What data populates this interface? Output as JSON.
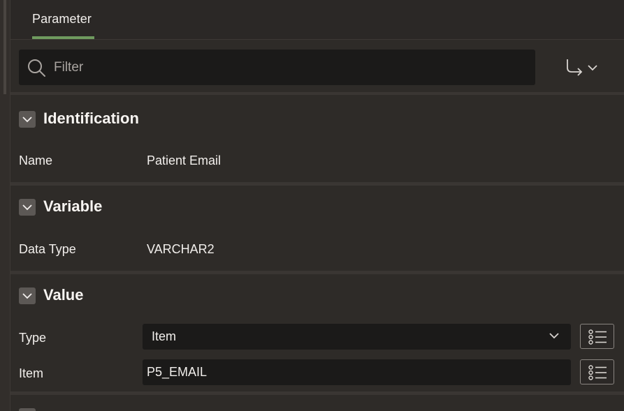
{
  "tabs": [
    {
      "label": "Parameter",
      "active": true
    }
  ],
  "toolbar": {
    "filter_placeholder": "Filter",
    "search_icon": "search-icon",
    "goto_icon": "go-to-arrow-icon"
  },
  "sections": {
    "identification": {
      "title": "Identification",
      "fields": {
        "name_label": "Name",
        "name_value": "Patient Email"
      }
    },
    "variable": {
      "title": "Variable",
      "fields": {
        "data_type_label": "Data Type",
        "data_type_value": "VARCHAR2"
      }
    },
    "value": {
      "title": "Value",
      "fields": {
        "type_label": "Type",
        "type_value": "Item",
        "item_label": "Item",
        "item_value": "P5_EMAIL"
      }
    }
  },
  "colors": {
    "background": "#2e2b28",
    "field_background": "#1b1a19",
    "active_tab_accent": "#6f9b5f",
    "text": "#f2efec"
  }
}
